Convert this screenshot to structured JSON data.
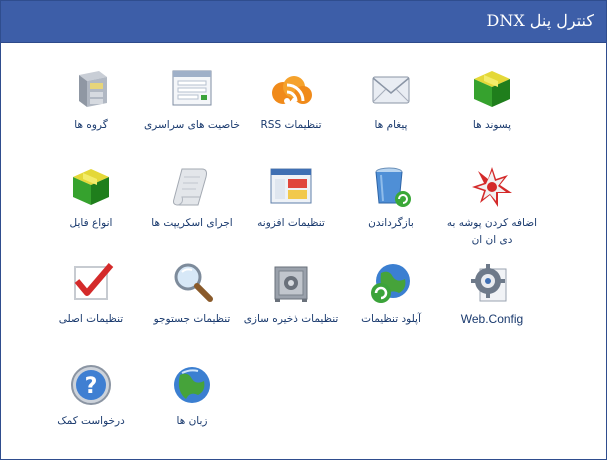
{
  "header": {
    "title": "کنترل پنل DNX"
  },
  "items": [
    {
      "label": "پسوند ها",
      "icon": "green-cube-icon"
    },
    {
      "label": "پیغام ها",
      "icon": "envelope-icon"
    },
    {
      "label": "تنظیمات RSS",
      "icon": "rss-feed-icon"
    },
    {
      "label": "خاصیت های سراسری",
      "icon": "form-window-icon"
    },
    {
      "label": "گروه ها",
      "icon": "file-cabinet-icon"
    },
    {
      "label": "اضافه کردن پوشه به دی ان ان",
      "icon": "add-folder-star-icon"
    },
    {
      "label": "بازگرداندن",
      "icon": "recycle-bin-icon"
    },
    {
      "label": "تنظیمات افزونه",
      "icon": "extension-window-icon"
    },
    {
      "label": "اجرای اسکریپت ها",
      "icon": "script-scroll-icon"
    },
    {
      "label": "انواع فایل",
      "icon": "file-types-cube-icon"
    },
    {
      "label": "Web.Config",
      "icon": "gear-document-icon"
    },
    {
      "label": "آپلود تنظیمات",
      "icon": "globe-sync-icon"
    },
    {
      "label": "تنظیمات ذخیره سازی",
      "icon": "safe-icon"
    },
    {
      "label": "تنظیمات جستوجو",
      "icon": "magnifier-icon"
    },
    {
      "label": "تنظیمات اصلی",
      "icon": "checkmark-icon"
    },
    {
      "label": "زبان ها",
      "icon": "globe-icon"
    },
    {
      "label": "درخواست کمک",
      "icon": "help-question-icon"
    }
  ]
}
